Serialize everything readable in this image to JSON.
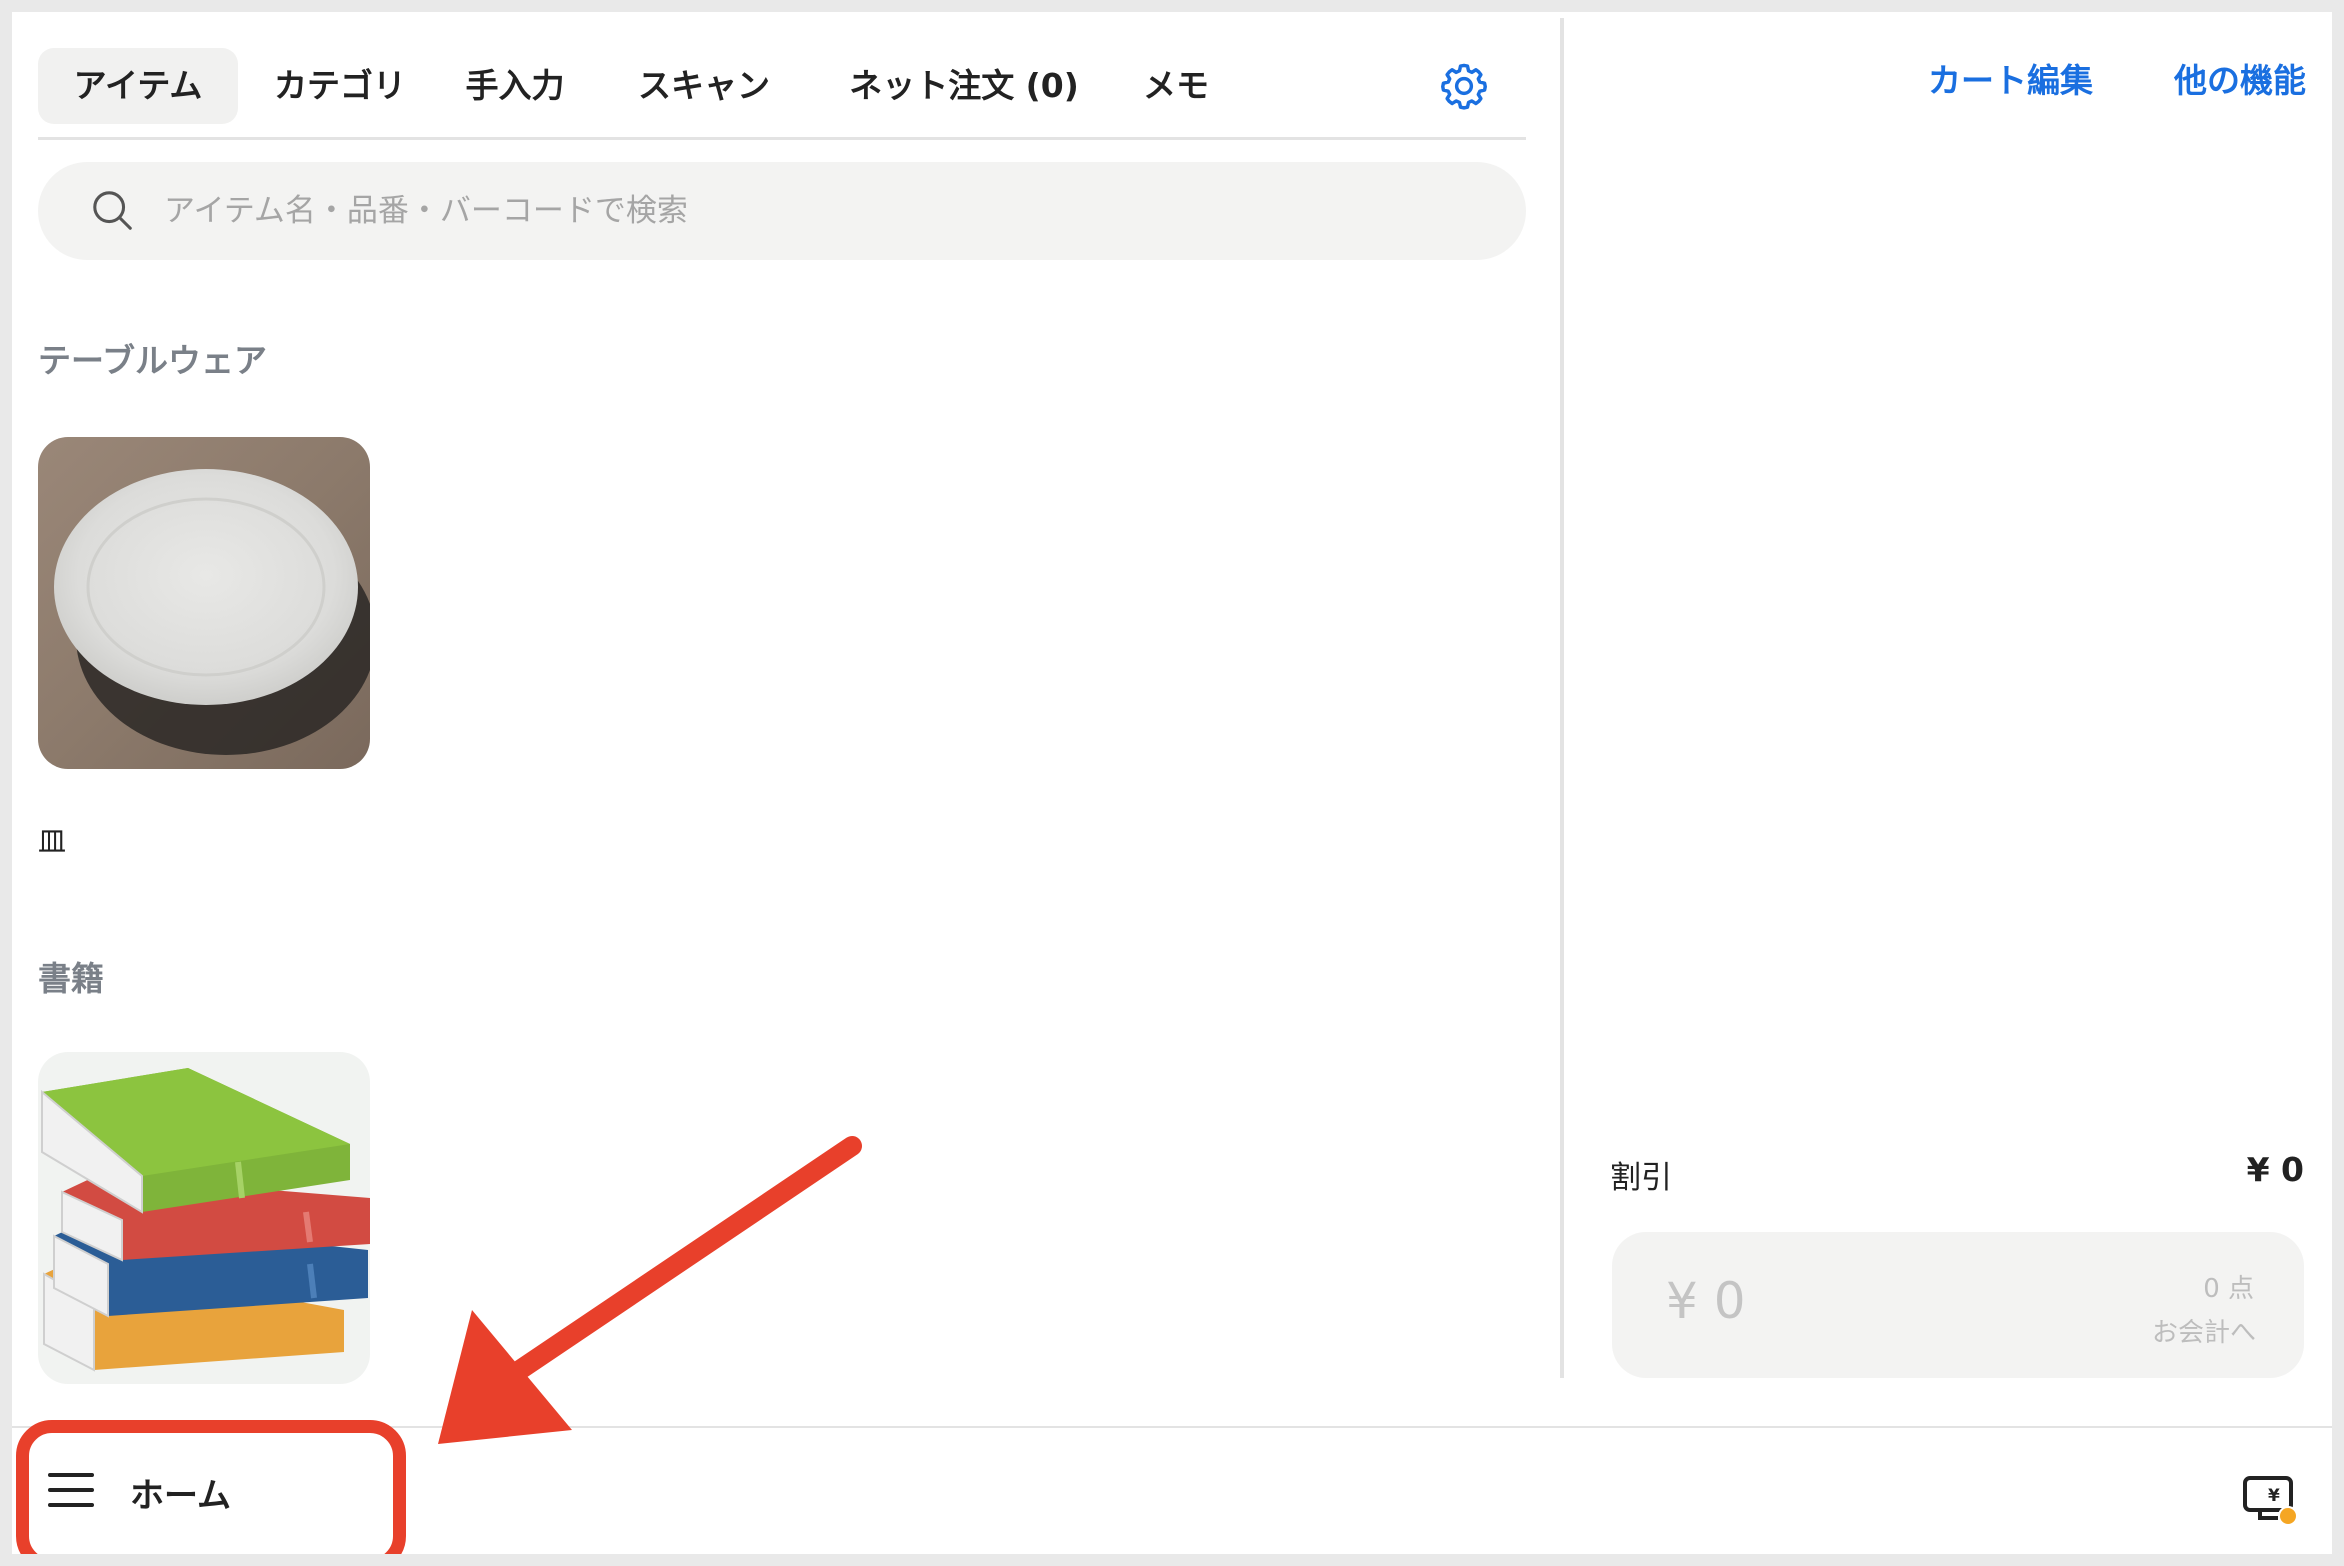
{
  "tabs": [
    {
      "label": "アイテム",
      "active": true
    },
    {
      "label": "カテゴリ",
      "active": false
    },
    {
      "label": "手入力",
      "active": false
    },
    {
      "label": "スキャン",
      "active": false
    },
    {
      "label": "ネット注文 (0)",
      "active": false
    },
    {
      "label": "メモ",
      "active": false
    }
  ],
  "settings_icon": "gear-icon",
  "search": {
    "placeholder": "アイテム名・品番・バーコードで検索",
    "value": "",
    "icon": "search-icon"
  },
  "sections": [
    {
      "title": "テーブルウェア",
      "items": [
        {
          "name": "皿",
          "image": "plate-image"
        }
      ]
    },
    {
      "title": "書籍",
      "items": [
        {
          "name": "",
          "image": "books-image"
        }
      ]
    }
  ],
  "right_panel": {
    "cart_edit": "カート編集",
    "more_features": "他の機能",
    "discount_label": "割引",
    "discount_value": "¥ 0",
    "checkout": {
      "total": "¥ 0",
      "count": "0 点",
      "label": "お会計へ"
    }
  },
  "bottom_bar": {
    "home_label": "ホーム",
    "menu_icon": "hamburger-icon",
    "register_icon": "register-icon"
  },
  "colors": {
    "accent": "#1a6fe0",
    "annotation": "#e8402b",
    "highlight_dot": "#f5a623"
  }
}
